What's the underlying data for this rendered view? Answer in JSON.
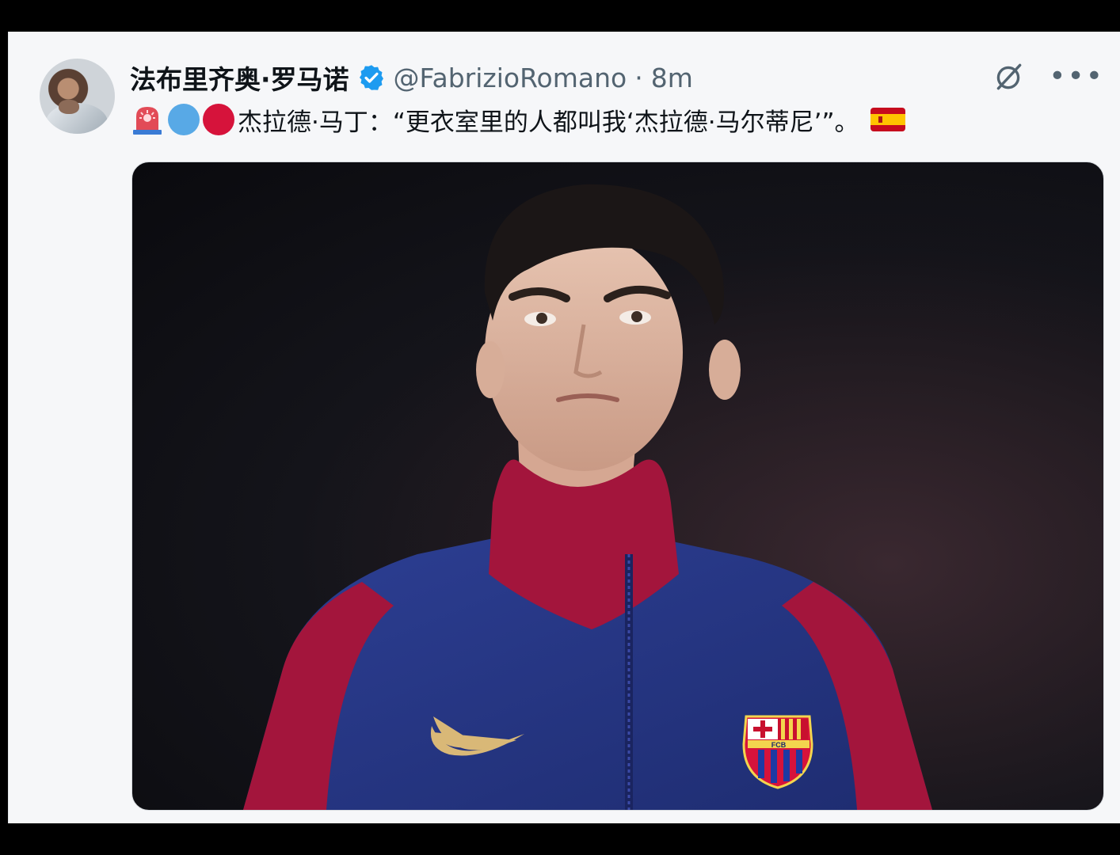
{
  "post": {
    "author_name": "法布里齐奥·罗马诺",
    "handle": "@FabrizioRomano",
    "separator": "·",
    "time": "8m",
    "text": "杰拉德·马丁：“更衣室里的人都叫我‘杰拉德·马尔蒂尼’”。",
    "emoji": [
      "siren-icon",
      "blue-circle-icon",
      "red-circle-icon",
      "spain-flag-icon"
    ],
    "media": {
      "kind": "photo",
      "subject": "player portrait in FC Barcelona jacket",
      "crest_letters": "FCB"
    }
  },
  "colors": {
    "background": "#f6f7f9",
    "text": "#0f1419",
    "muted": "#536471",
    "verified": "#1d9bf0",
    "blue_dot": "#58a9e6",
    "red_dot": "#d6133b",
    "jacket_blue": "#2b3c8c",
    "jacket_red": "#a3153c"
  }
}
